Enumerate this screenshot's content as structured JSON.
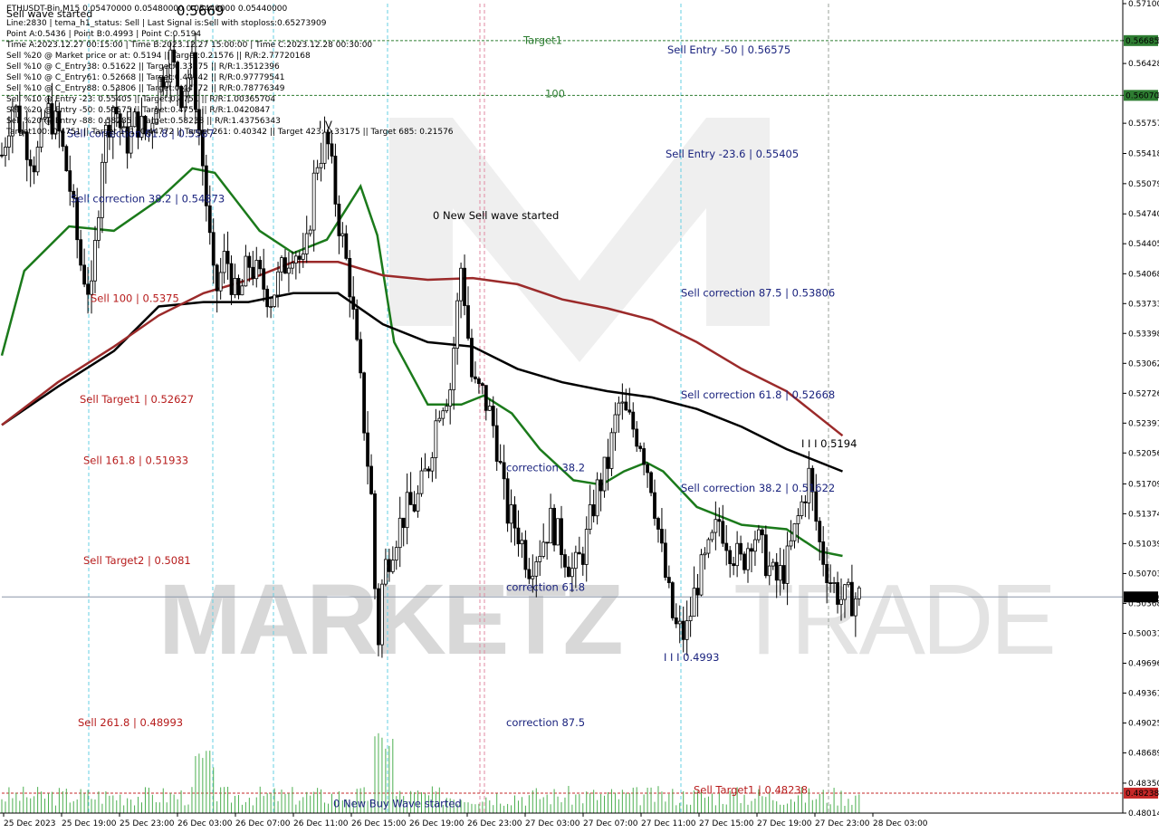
{
  "header": {
    "symbol_line": "ETHUSDT-Bin,M15  0.05470000 0.05480000 0.05440000 0.05440000",
    "wave_label": "Sell wave started",
    "big_price": "0.5669",
    "info_lines": [
      "Line:2830 | tema_h1_status: Sell | Last Signal is:Sell with stoploss:0.65273909",
      "Point A:0.5436 | Point B:0.4993 | Point C:0.5194",
      "Time A:2023.12.27 00:15:00 | Time B:2023.12.27 15:00:00 | Time C:2023.12.28 00:30:00",
      "Sell %20 @ Market price or at: 0.5194 || Target:0.21576 || R/R:2.77720168",
      "Sell %10 @ C_Entry38: 0.51622 || Target:0.33175 || R/R:1.3512396",
      "Sell %10 @ C_Entry61: 0.52668 || Target:0.40342 || R/R:0.97779541",
      "Sell %10 @ C_Entry88: 0.53806 || Target:0.44772 || R/R:0.78776349",
      "Sell %10 @ Entry -23: 0.55405 || Target:0.4751 || R/R:1.00365704",
      "Sell %20 @ Entry -50: 0.56575 || Target:0.4751 || R/R:1.0420847",
      "Sell %20 @ Entry -88: 0.58285 || Target:0.58238 || R/R:1.43756343",
      "Target100: 0.4751 || Target 161: 0.44772 || Target 261: 0.40342 || Target 423: 0.33175 || Target 685: 0.21576"
    ]
  },
  "watermark": {
    "left": "MARKETZ",
    "right": "TRADE"
  },
  "chart_data": {
    "type": "candlestick",
    "symbol": "ETHUSDT-Bin",
    "timeframe": "M15",
    "ylim": [
      0.48014,
      0.571
    ],
    "price_ticks": [
      "0.57100",
      "0.56685",
      "0.56428",
      "0.56070",
      "0.55757",
      "0.55418",
      "0.55079",
      "0.54740",
      "0.54405",
      "0.54068",
      "0.53733",
      "0.53398",
      "0.53062",
      "0.52726",
      "0.52391",
      "0.52056",
      "0.51709",
      "0.51374",
      "0.51039",
      "0.50703",
      "0.50368",
      "0.50031",
      "0.49696",
      "0.49361",
      "0.49025",
      "0.48689",
      "0.48350",
      "0.48014"
    ],
    "x_labels": [
      "25 Dec 2023",
      "25 Dec 19:00",
      "25 Dec 23:00",
      "26 Dec 03:00",
      "26 Dec 07:00",
      "26 Dec 11:00",
      "26 Dec 15:00",
      "26 Dec 19:00",
      "26 Dec 23:00",
      "27 Dec 03:00",
      "27 Dec 07:00",
      "27 Dec 11:00",
      "27 Dec 15:00",
      "27 Dec 19:00",
      "27 Dec 23:00",
      "28 Dec 03:00"
    ],
    "current_price": {
      "value": 0.5044,
      "label": "0.50440"
    },
    "level_lines": [
      {
        "name": "Target1",
        "value": 0.56685,
        "label": "0.56685",
        "color": "#2e7d32"
      },
      {
        "name": "100",
        "value": 0.5607,
        "label": "0.56070",
        "color": "#2e7d32"
      },
      {
        "name": "Sell Target1",
        "value": 0.48238,
        "label": "0.48238",
        "color": "#c62828"
      }
    ],
    "annotations": [
      {
        "text": "Target1",
        "value": 0.5665,
        "color": "#2e7d32"
      },
      {
        "text": "100",
        "value": 0.5605,
        "color": "#2e7d32"
      },
      {
        "text": "Sell Entry -50 | 0.56575",
        "value": 0.5654,
        "color": "#1a237e"
      },
      {
        "text": "Sell Entry -23.6 | 0.55405",
        "value": 0.5537,
        "color": "#1a237e"
      },
      {
        "text": "0 New Sell wave started",
        "value": 0.5468,
        "color": "#000000"
      },
      {
        "text": "Sell correction 87.5 | 0.53806",
        "value": 0.5381,
        "color": "#1a237e"
      },
      {
        "text": "Sell correction 61.8 | 0.52668",
        "value": 0.5267,
        "color": "#1a237e"
      },
      {
        "text": "Sell correction 38.2 | 0.51622",
        "value": 0.5162,
        "color": "#1a237e"
      },
      {
        "text": "Sell correction 61.8 | 0.5587",
        "value": 0.556,
        "color": "#1a237e"
      },
      {
        "text": "Sell correction 38.2 | 0.54873",
        "value": 0.5487,
        "color": "#1a237e"
      },
      {
        "text": "Sell 100 | 0.5375",
        "value": 0.5375,
        "color": "#b71c1c"
      },
      {
        "text": "Sell Target1 | 0.52627",
        "value": 0.5262,
        "color": "#b71c1c"
      },
      {
        "text": "Sell 161.8 | 0.51933",
        "value": 0.5193,
        "color": "#b71c1c"
      },
      {
        "text": "Sell Target2 | 0.5081",
        "value": 0.5081,
        "color": "#b71c1c"
      },
      {
        "text": "Sell 261.8 | 0.48993",
        "value": 0.4899,
        "color": "#b71c1c"
      },
      {
        "text": "Sell Target1 | 0.48238",
        "value": 0.4823,
        "color": "#b71c1c"
      },
      {
        "text": "correction 38.2",
        "value": 0.5185,
        "color": "#1a237e"
      },
      {
        "text": "correction 61.8",
        "value": 0.5051,
        "color": "#1a237e"
      },
      {
        "text": "correction 87.5",
        "value": 0.4899,
        "color": "#1a237e"
      },
      {
        "text": "0 New Buy Wave started",
        "value": 0.4808,
        "color": "#1a237e"
      },
      {
        "text": "I V",
        "value": 0.557,
        "color": "#000000"
      },
      {
        "text": "I I I 0.5194",
        "value": 0.5212,
        "color": "#000000"
      },
      {
        "text": "I I I 0.4993",
        "value": 0.4972,
        "color": "#1a237e"
      }
    ],
    "moving_averages": [
      {
        "color": "#1b7a1b",
        "points": [
          [
            0,
            0.5315
          ],
          [
            0.02,
            0.541
          ],
          [
            0.06,
            0.546
          ],
          [
            0.1,
            0.5455
          ],
          [
            0.14,
            0.549
          ],
          [
            0.17,
            0.5525
          ],
          [
            0.19,
            0.552
          ],
          [
            0.23,
            0.5455
          ],
          [
            0.26,
            0.543
          ],
          [
            0.29,
            0.5445
          ],
          [
            0.32,
            0.5505
          ],
          [
            0.335,
            0.545
          ],
          [
            0.35,
            0.533
          ],
          [
            0.38,
            0.526
          ],
          [
            0.41,
            0.526
          ],
          [
            0.43,
            0.527
          ],
          [
            0.455,
            0.525
          ],
          [
            0.48,
            0.521
          ],
          [
            0.51,
            0.5175
          ],
          [
            0.535,
            0.517
          ],
          [
            0.555,
            0.5185
          ],
          [
            0.575,
            0.5195
          ],
          [
            0.59,
            0.5185
          ],
          [
            0.62,
            0.5145
          ],
          [
            0.66,
            0.5125
          ],
          [
            0.7,
            0.512
          ],
          [
            0.73,
            0.5095
          ],
          [
            0.75,
            0.509
          ]
        ]
      },
      {
        "color": "#000000",
        "points": [
          [
            0,
            0.5237
          ],
          [
            0.05,
            0.528
          ],
          [
            0.1,
            0.532
          ],
          [
            0.14,
            0.537
          ],
          [
            0.18,
            0.5375
          ],
          [
            0.22,
            0.5375
          ],
          [
            0.26,
            0.5385
          ],
          [
            0.3,
            0.5385
          ],
          [
            0.34,
            0.535
          ],
          [
            0.38,
            0.533
          ],
          [
            0.42,
            0.5325
          ],
          [
            0.46,
            0.53
          ],
          [
            0.5,
            0.5285
          ],
          [
            0.54,
            0.5275
          ],
          [
            0.58,
            0.5268
          ],
          [
            0.62,
            0.5255
          ],
          [
            0.66,
            0.5235
          ],
          [
            0.7,
            0.521
          ],
          [
            0.75,
            0.5185
          ]
        ]
      },
      {
        "color": "#9b2a2a",
        "points": [
          [
            0,
            0.5237
          ],
          [
            0.05,
            0.5285
          ],
          [
            0.1,
            0.5325
          ],
          [
            0.14,
            0.536
          ],
          [
            0.18,
            0.5385
          ],
          [
            0.22,
            0.54
          ],
          [
            0.26,
            0.542
          ],
          [
            0.3,
            0.542
          ],
          [
            0.34,
            0.5405
          ],
          [
            0.38,
            0.54
          ],
          [
            0.42,
            0.5402
          ],
          [
            0.46,
            0.5395
          ],
          [
            0.5,
            0.5378
          ],
          [
            0.54,
            0.5368
          ],
          [
            0.58,
            0.5355
          ],
          [
            0.62,
            0.533
          ],
          [
            0.66,
            0.53
          ],
          [
            0.7,
            0.5275
          ],
          [
            0.75,
            0.5225
          ]
        ]
      }
    ],
    "close_path": [
      [
        0,
        0.554
      ],
      [
        0.01,
        0.56
      ],
      [
        0.02,
        0.556
      ],
      [
        0.03,
        0.553
      ],
      [
        0.04,
        0.559
      ],
      [
        0.05,
        0.557
      ],
      [
        0.06,
        0.551
      ],
      [
        0.07,
        0.542
      ],
      [
        0.08,
        0.538
      ],
      [
        0.09,
        0.555
      ],
      [
        0.1,
        0.56
      ],
      [
        0.11,
        0.555
      ],
      [
        0.12,
        0.558
      ],
      [
        0.13,
        0.556
      ],
      [
        0.14,
        0.562
      ],
      [
        0.15,
        0.565
      ],
      [
        0.16,
        0.561
      ],
      [
        0.17,
        0.564
      ],
      [
        0.18,
        0.552
      ],
      [
        0.19,
        0.538
      ],
      [
        0.2,
        0.543
      ],
      [
        0.21,
        0.537
      ],
      [
        0.22,
        0.542
      ],
      [
        0.23,
        0.54
      ],
      [
        0.24,
        0.538
      ],
      [
        0.25,
        0.541
      ],
      [
        0.26,
        0.544
      ],
      [
        0.27,
        0.541
      ],
      [
        0.28,
        0.553
      ],
      [
        0.29,
        0.556
      ],
      [
        0.3,
        0.547
      ],
      [
        0.31,
        0.54
      ],
      [
        0.32,
        0.528
      ],
      [
        0.33,
        0.515
      ],
      [
        0.335,
        0.498
      ],
      [
        0.34,
        0.507
      ],
      [
        0.35,
        0.511
      ],
      [
        0.36,
        0.514
      ],
      [
        0.37,
        0.515
      ],
      [
        0.38,
        0.519
      ],
      [
        0.39,
        0.526
      ],
      [
        0.4,
        0.528
      ],
      [
        0.41,
        0.542
      ],
      [
        0.415,
        0.535
      ],
      [
        0.42,
        0.528
      ],
      [
        0.43,
        0.527
      ],
      [
        0.44,
        0.523
      ],
      [
        0.45,
        0.514
      ],
      [
        0.46,
        0.512
      ],
      [
        0.47,
        0.508
      ],
      [
        0.48,
        0.51
      ],
      [
        0.49,
        0.513
      ],
      [
        0.5,
        0.51
      ],
      [
        0.51,
        0.507
      ],
      [
        0.52,
        0.51
      ],
      [
        0.53,
        0.516
      ],
      [
        0.54,
        0.519
      ],
      [
        0.55,
        0.526
      ],
      [
        0.56,
        0.524
      ],
      [
        0.57,
        0.522
      ],
      [
        0.58,
        0.517
      ],
      [
        0.59,
        0.508
      ],
      [
        0.6,
        0.501
      ],
      [
        0.61,
        0.5
      ],
      [
        0.62,
        0.506
      ],
      [
        0.63,
        0.509
      ],
      [
        0.64,
        0.513
      ],
      [
        0.65,
        0.51
      ],
      [
        0.66,
        0.508
      ],
      [
        0.67,
        0.512
      ],
      [
        0.68,
        0.509
      ],
      [
        0.69,
        0.506
      ],
      [
        0.7,
        0.508
      ],
      [
        0.71,
        0.513
      ],
      [
        0.72,
        0.518
      ],
      [
        0.73,
        0.51
      ],
      [
        0.74,
        0.506
      ],
      [
        0.75,
        0.504
      ],
      [
        0.765,
        0.5044
      ]
    ]
  },
  "volume_panel": {
    "present": true
  }
}
